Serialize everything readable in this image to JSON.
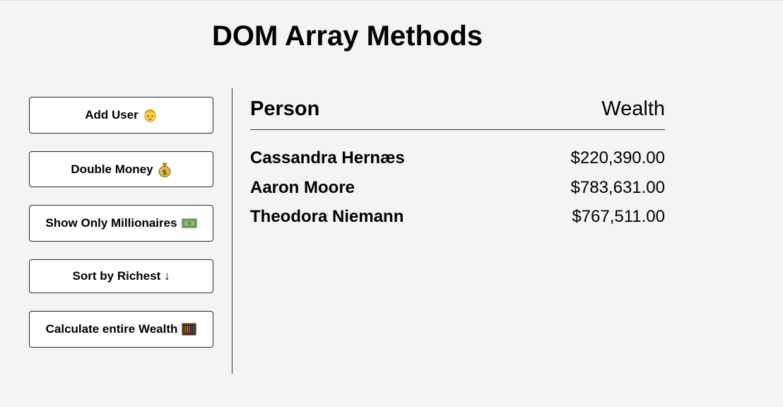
{
  "page": {
    "title": "DOM Array Methods"
  },
  "sidebar": {
    "buttons": [
      {
        "label": "Add User",
        "icon": "person-face-icon"
      },
      {
        "label": "Double Money",
        "icon": "money-bag-icon"
      },
      {
        "label": "Show Only Millionaires",
        "icon": "banknote-icon"
      },
      {
        "label": "Sort by Richest ↓",
        "icon": ""
      },
      {
        "label": "Calculate entire Wealth",
        "icon": "abacus-icon"
      }
    ]
  },
  "table": {
    "headers": {
      "person": "Person",
      "wealth": "Wealth"
    },
    "rows": [
      {
        "name": "Cassandra Hernæs",
        "wealth": "$220,390.00"
      },
      {
        "name": "Aaron Moore",
        "wealth": "$783,631.00"
      },
      {
        "name": "Theodora Niemann",
        "wealth": "$767,511.00"
      }
    ]
  },
  "colors": {
    "background": "#f4f4f4",
    "button_background": "#ffffff",
    "border": "#2b2b2b"
  }
}
